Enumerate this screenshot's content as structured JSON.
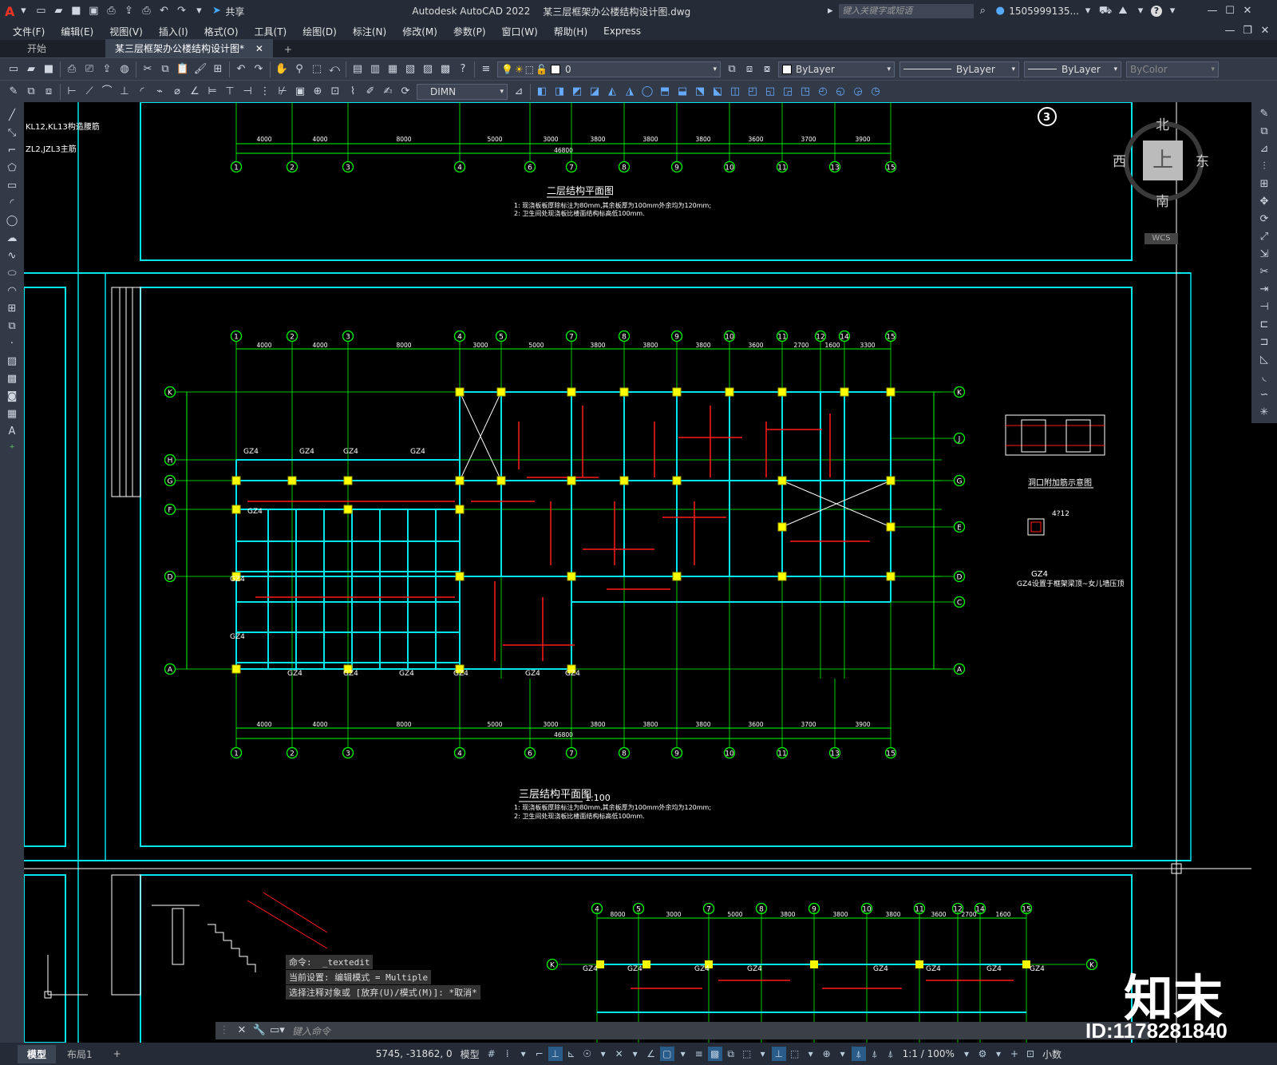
{
  "app": {
    "title": "Autodesk AutoCAD 2022",
    "filename": "某三层框架办公楼结构设计图.dwg",
    "share_label": "共享",
    "search_placeholder": "键入关键字或短语",
    "user": "1505999135...",
    "help": "?"
  },
  "menu": [
    "文件(F)",
    "编辑(E)",
    "视图(V)",
    "插入(I)",
    "格式(O)",
    "工具(T)",
    "绘图(D)",
    "标注(N)",
    "修改(M)",
    "参数(P)",
    "窗口(W)",
    "帮助(H)",
    "Express"
  ],
  "tabs": {
    "start": "开始",
    "doc": "某三层框架办公楼结构设计图*",
    "add": "+"
  },
  "toolbar": {
    "layer_value": "0",
    "color": "ByLayer",
    "linetype": "ByLayer",
    "lineweight": "ByLayer",
    "plotstyle": "ByColor",
    "dimstyle": "DIMN"
  },
  "viewcube": {
    "north": "北",
    "south": "南",
    "east": "东",
    "west": "西",
    "top": "上",
    "wcs": "WCS"
  },
  "drawing": {
    "plan2_title": "二层结构平面图",
    "plan3_title": "三层结构平面图",
    "plan3_scale": "1:100",
    "note1": "1: 现浇板板厚除标注为80mm,其余板厚为100mm外余均为120mm;",
    "note2": "2: 卫生间处现浇板比楼面结构标高低100mm.",
    "legend_kl": "KL12,KL13构造腰筋",
    "legend_zl": "ZL2,JZL3主筋",
    "grid_top": [
      "1",
      "2",
      "3",
      "4",
      "5",
      "7",
      "8",
      "9",
      "10",
      "11",
      "12",
      "14",
      "15"
    ],
    "grid_bottom": [
      "1",
      "2",
      "3",
      "4",
      "6",
      "7",
      "8",
      "9",
      "10",
      "11",
      "13",
      "15"
    ],
    "grid_left": [
      "K",
      "H",
      "G",
      "F",
      "D",
      "A"
    ],
    "grid_right": [
      "K",
      "J",
      "G",
      "E",
      "D",
      "C",
      "A"
    ],
    "dims_top": [
      "4000",
      "4000",
      "8000",
      "3000",
      "5000",
      "3800",
      "3800",
      "3800",
      "3600",
      "2700",
      "1600",
      "3300"
    ],
    "dims_bottom": [
      "4000",
      "4000",
      "8000",
      "5000",
      "3000",
      "3800",
      "3800",
      "3800",
      "3600",
      "3700",
      "3900"
    ],
    "total": "46800",
    "col_label": "GZ4",
    "detail_title": "洞口附加筋示意图",
    "detail_gz4": "GZ4设置于框架梁顶~女儿墙压顶",
    "detail_gz4_label": "GZ4",
    "section_4712": "4?12",
    "marker3": "3"
  },
  "command": {
    "line1": "命令:  _textedit",
    "line2": "当前设置: 编辑模式 = Multiple",
    "line3": "选择注释对象或 [放弃(U)/模式(M)]: *取消*",
    "input_placeholder": "键入命令"
  },
  "status": {
    "model_tab": "模型",
    "layout_tab": "布局1",
    "add": "+",
    "coords": "5745, -31862, 0",
    "model": "模型",
    "scale": "1:1 / 100%",
    "units": "小数"
  },
  "watermark": {
    "brand": "知末",
    "id": "ID:1178281840"
  },
  "colors": {
    "cyan": "#00e5ee",
    "green": "#00ff00",
    "red": "#ff1a1a",
    "yellow": "#ffff00",
    "white": "#ffffff"
  }
}
